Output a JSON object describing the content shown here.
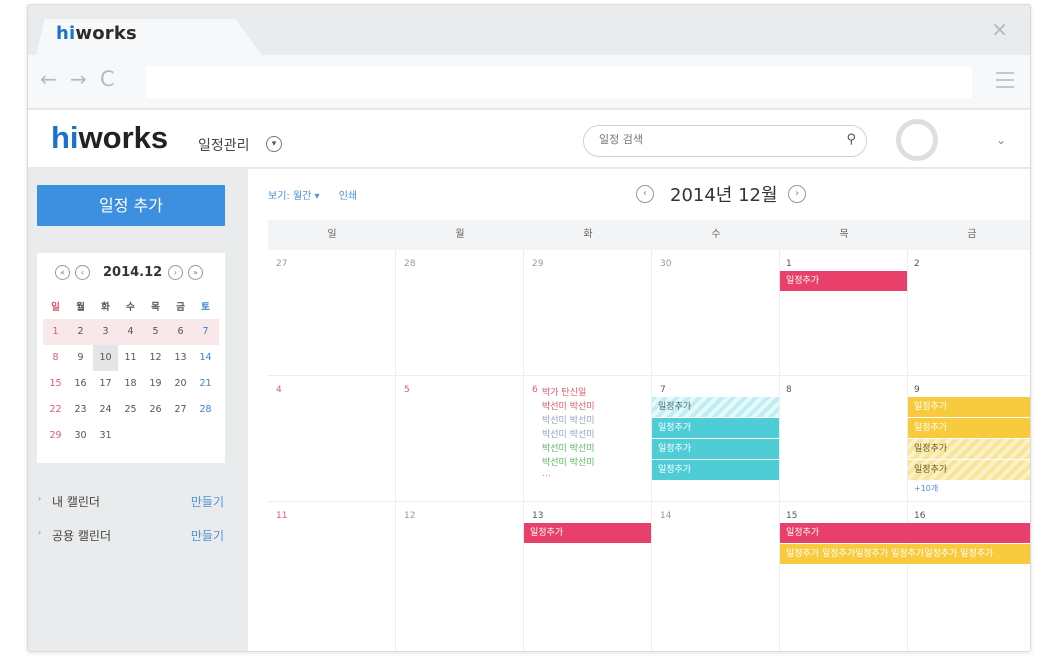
{
  "browser": {
    "tab_brand_hi": "hi",
    "tab_brand_rest": "works",
    "close_glyph": "×",
    "back_glyph": "←",
    "forward_glyph": "→",
    "reload_glyph": "C"
  },
  "header": {
    "logo_hi": "hi",
    "logo_rest": "works",
    "app_title": "일정관리",
    "search_placeholder": "일정 검색",
    "search_icon": "🔍",
    "avatar_chevron": "⌄"
  },
  "sidebar": {
    "add_button": "일정 추가",
    "mini_calendar": {
      "title": "2014.12",
      "weekdays": [
        "일",
        "월",
        "화",
        "수",
        "목",
        "금",
        "토"
      ],
      "weeks": [
        [
          "1",
          "2",
          "3",
          "4",
          "5",
          "6",
          "7"
        ],
        [
          "8",
          "9",
          "10",
          "11",
          "12",
          "13",
          "14"
        ],
        [
          "15",
          "16",
          "17",
          "18",
          "19",
          "20",
          "21"
        ],
        [
          "22",
          "23",
          "24",
          "25",
          "26",
          "27",
          "28"
        ],
        [
          "29",
          "30",
          "31",
          "",
          "",
          "",
          ""
        ]
      ]
    },
    "my_calendar_label": "내 캘린더",
    "shared_calendar_label": "공용 캘린더",
    "make_label": "만들기"
  },
  "main": {
    "view_label": "보기: 월간 ▾",
    "print_label": "인쇄",
    "month_title": "2014년 12월",
    "weekday_headers": [
      "일",
      "월",
      "화",
      "수",
      "목",
      "금"
    ],
    "weeks": [
      [
        "27",
        "28",
        "29",
        "30",
        "1",
        "2"
      ],
      [
        "4",
        "5",
        "6",
        "7",
        "8",
        "9"
      ],
      [
        "11",
        "12",
        "13",
        "14",
        "15",
        "16"
      ]
    ],
    "events": {
      "add_event": "일정추가",
      "birthday": "박가 탄신일",
      "birthday_names": "박선미 박선미",
      "more_dots": "…",
      "more_count": "+10개",
      "long_bar": "일정추가 일정추가일정추가 일정추가일정추가 일정추가"
    }
  },
  "colors": {
    "brand_blue": "#1a73c8",
    "button_blue": "#3d8fdf",
    "event_red": "#e8406a",
    "event_teal": "#4ecdd6",
    "event_yellow": "#f7cb3d"
  }
}
